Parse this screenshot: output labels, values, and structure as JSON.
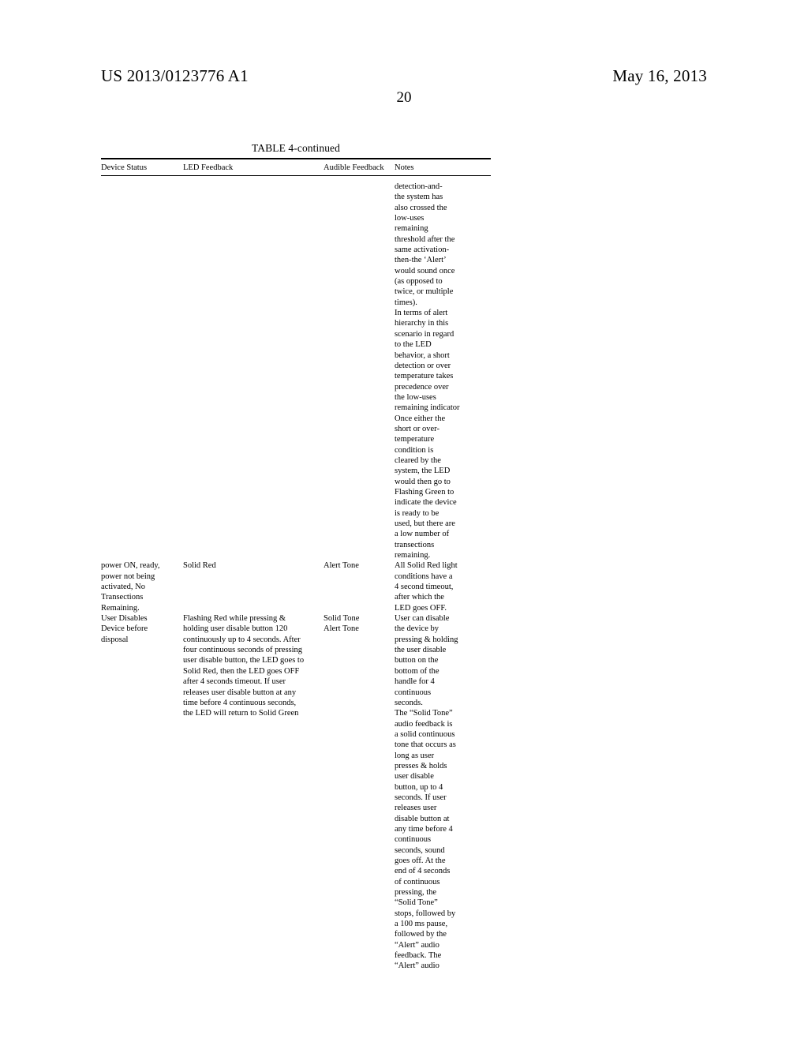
{
  "header": {
    "publication_number": "US 2013/0123776 A1",
    "publication_date": "May 16, 2013",
    "page_number": "20"
  },
  "table": {
    "caption": "TABLE 4-continued",
    "columns": [
      "Device Status",
      "LED Feedback",
      "Audible Feedback",
      "Notes"
    ],
    "notes_continued_lines": [
      "detection-and-",
      "the system has",
      "also crossed the",
      "low-uses",
      "remaining",
      "threshold after the",
      "same activation-",
      "then-the ‘Alert’",
      "would sound once",
      "(as opposed to",
      "twice, or multiple",
      "times).",
      "In terms of alert",
      "hierarchy in this",
      "scenario in regard",
      "to the LED",
      "behavior, a short",
      "detection or over",
      "temperature takes",
      "precedence over",
      "the low-uses",
      "remaining indicator",
      "Once either the",
      "short or over-",
      "temperature",
      "condition is",
      "cleared by the",
      "system, the LED",
      "would then go to",
      "Flashing Green to",
      "indicate the device",
      "is ready to be",
      "used, but there are",
      "a low number of",
      "transections",
      "remaining."
    ],
    "rows": [
      {
        "device_status_lines": [
          "power ON, ready,",
          "power not being",
          "activated, No",
          "Transections",
          "Remaining."
        ],
        "led_feedback_lines": [
          "Solid Red"
        ],
        "audible_feedback_lines": [
          "Alert Tone"
        ],
        "notes_lines": [
          "All Solid Red light",
          "conditions have a",
          "4 second timeout,",
          "after which the",
          "LED goes OFF."
        ]
      },
      {
        "device_status_lines": [
          "User Disables",
          "Device before",
          "disposal"
        ],
        "led_feedback_lines": [
          "Flashing Red while pressing &",
          "holding user disable button 120",
          "continuously up to 4 seconds. After",
          "four continuous seconds of pressing",
          "user disable button, the LED goes to",
          "Solid Red, then the LED goes OFF",
          "after 4 seconds timeout. If user",
          "releases user disable button at any",
          "time before 4 continuous seconds,",
          "the LED will return to Solid Green"
        ],
        "audible_feedback_lines": [
          "Solid Tone",
          "Alert Tone"
        ],
        "notes_lines": [
          "User can disable",
          "the device by",
          "pressing & holding",
          "the user disable",
          "button on the",
          "bottom of the",
          "handle for 4",
          "continuous",
          "seconds.",
          "The “Solid Tone”",
          "audio feedback is",
          "a solid continuous",
          "tone that occurs as",
          "long as user",
          "presses & holds",
          "user disable",
          "button, up to 4",
          "seconds. If user",
          "releases user",
          "disable button at",
          "any time before 4",
          "continuous",
          "seconds, sound",
          "goes off. At the",
          "end of 4 seconds",
          "of continuous",
          "pressing, the",
          "“Solid Tone”",
          "stops, followed by",
          "a 100 ms pause,",
          "followed by the",
          "“Alert” audio",
          "feedback. The",
          "“Alert” audio"
        ]
      }
    ]
  }
}
